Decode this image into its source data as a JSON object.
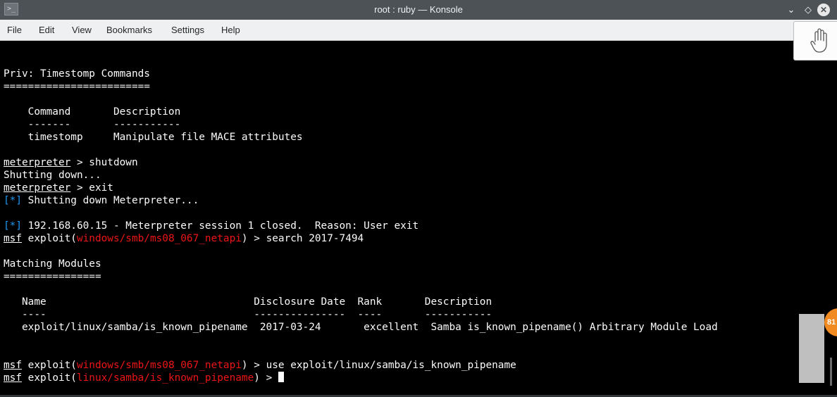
{
  "window": {
    "title": "root : ruby — Konsole",
    "app_icon": "terminal-icon",
    "controls": [
      "minimize-icon",
      "keep-above-icon",
      "close-icon"
    ]
  },
  "menu": [
    "File",
    "Edit",
    "View",
    "Bookmarks",
    "Settings",
    "Help"
  ],
  "colors": {
    "terminal_bg": "#000000",
    "terminal_fg": "#fcfcfc",
    "module_red": "#ed1515",
    "info_blue": "#1d99f3",
    "titlebar": "#4d5257",
    "menubar": "#eff0f1",
    "badge_orange": "#f28a22"
  },
  "terminal": {
    "timestomp_header": "Priv: Timestomp Commands",
    "timestomp_rule": "========================",
    "cmd_table_header": "    Command       Description",
    "cmd_table_rule": "    -------       -----------",
    "cmd_table_row": "    timestomp     Manipulate file MACE attributes",
    "prompt_meterpreter": "meterpreter",
    "cmd_shutdown": " > shutdown",
    "out_shutting": "Shutting down...",
    "cmd_exit": " > exit",
    "info_marker": "[*]",
    "info_shutting_meterpreter": " Shutting down Meterpreter...",
    "info_session_closed": " 192.168.60.15 - Meterpreter session 1 closed.  Reason: User exit",
    "prompt_msf": "msf",
    "exploit_open": " exploit(",
    "module_ms08": "windows/smb/ms08_067_netapi",
    "cmd_search": ") > search 2017-7494",
    "matching_header": "Matching Modules",
    "matching_rule": "================",
    "mod_table_header": "   Name                                  Disclosure Date  Rank       Description",
    "mod_table_rule": "   ----                                  ---------------  ----       -----------",
    "mod_table_row": "   exploit/linux/samba/is_known_pipename  2017-03-24       excellent  Samba is_known_pipename() Arbitrary Module Load",
    "cmd_use": ") > use exploit/linux/samba/is_known_pipename",
    "module_samba": "linux/samba/is_known_pipename",
    "prompt_close": ") > "
  },
  "overlay": {
    "hand_icon": "hand-cursor-icon",
    "badge_text": "81"
  }
}
